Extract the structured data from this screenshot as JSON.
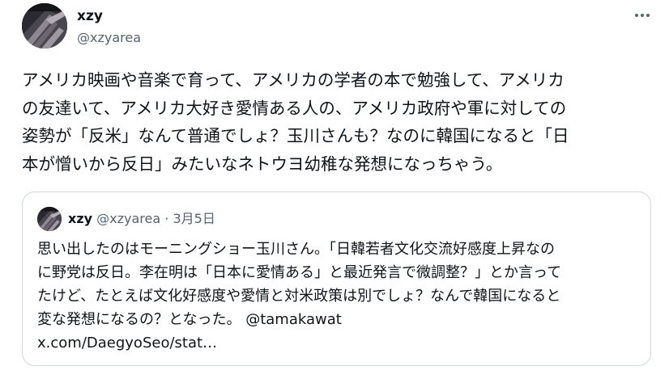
{
  "tweet": {
    "author_name": "xzy",
    "author_handle": "@xzyarea",
    "more_icon": "more-horizontal-icon",
    "text_lines": [
      "アメリカ映画や音楽で育って、アメリカの学者の本で勉強して、アメリカ",
      "の友達いて、アメリカ大好き愛情ある人の、アメリカ政府や軍に対しての",
      "姿勢が「反米」なんて普通でしょ？玉川さんも？なのに韓国になると「日",
      "本が憎いから反日」みたいなネトウヨ幼稚な発想になっちゃう。"
    ]
  },
  "quote": {
    "author_name": "xzy",
    "author_handle": "@xzyarea",
    "separator": "·",
    "date": "3月5日",
    "text_lines": [
      "思い出したのはモーニングショー玉川さん。「日韓若者文化交流好感度上昇なの",
      "に野党は反日。李在明は「日本に愛情ある」と最近発言で微調整？」とか言って",
      "たけど、たとえば文化好感度や愛情と対米政策は別でしょ？なんで韓国になると"
    ],
    "line4_text": "変な発想になるの？となった。",
    "mention": "@tamakawat",
    "link": "x.com/DaegyoSeo/stat…"
  },
  "colors": {
    "text": "#0f1419",
    "secondary": "#536471",
    "border": "#cfd9de",
    "background": "#ffffff"
  }
}
